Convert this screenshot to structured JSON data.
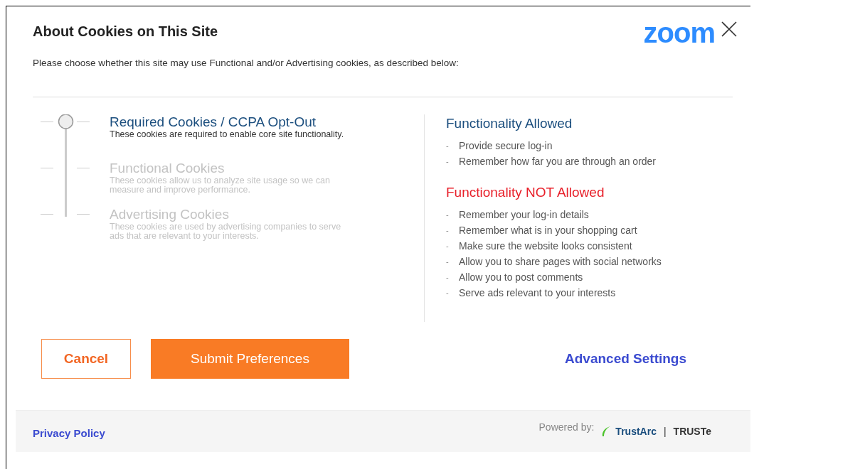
{
  "dialog": {
    "title": "About Cookies on This Site",
    "logo": "zoom",
    "subtitle": "Please choose whether this site may use Functional and/or Advertising cookies, as described below:"
  },
  "categories": [
    {
      "title": "Required Cookies / CCPA Opt-Out",
      "description": "These cookies are required to enable core site functionality.",
      "selected": true
    },
    {
      "title": "Functional Cookies",
      "description": "These cookies allow us to analyze site usage so we can measure and improve performance.",
      "selected": false
    },
    {
      "title": "Advertising Cookies",
      "description": "These cookies are used by advertising companies to serve ads that are relevant to your interests.",
      "selected": false
    }
  ],
  "functionality": [
    {
      "kind": "allowed",
      "heading": "Functionality Allowed",
      "bullet": "-",
      "items": [
        "Provide secure log-in",
        "Remember how far you are through an order"
      ]
    },
    {
      "kind": "not_allowed",
      "heading": "Functionality NOT Allowed",
      "bullet": "-",
      "items": [
        "Remember your log-in details",
        "Remember what is in your shopping cart",
        "Make sure the website looks consistent",
        "Allow you to share pages with social networks",
        "Allow you to post comments",
        "Serve ads relevant to your interests"
      ]
    }
  ],
  "buttons": {
    "cancel": "Cancel",
    "submit": "Submit Preferences",
    "advanced": "Advanced Settings"
  },
  "footer": {
    "link": "Privacy Policy",
    "powered_by": "Powered by:",
    "brand": "TrustArc",
    "separator": "|",
    "brand_2": "TRUSTe"
  }
}
